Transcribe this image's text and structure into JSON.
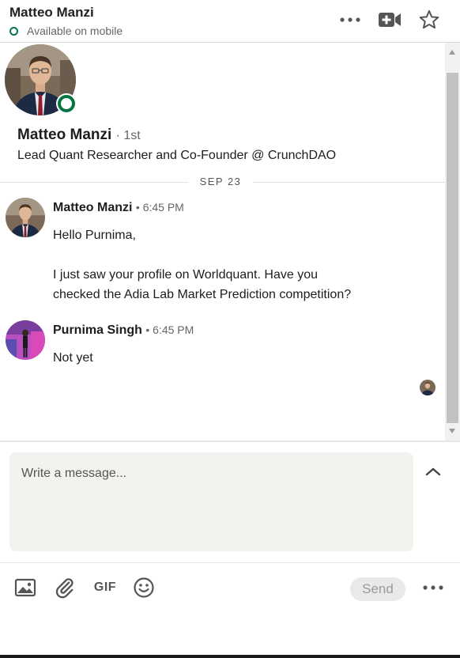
{
  "header": {
    "name": "Matteo Manzi",
    "status": "Available on mobile",
    "icons": [
      "more-icon",
      "video-call-icon",
      "star-icon"
    ]
  },
  "profile": {
    "name": "Matteo Manzi",
    "degree": "· 1st",
    "headline": "Lead Quant Researcher and Co-Founder @ CrunchDAO"
  },
  "date_divider": "SEP 23",
  "messages": [
    {
      "sender": "Matteo Manzi",
      "time": "• 6:45 PM",
      "lines": [
        "Hello Purnima,",
        "I just saw your profile on Worldquant. Have you",
        "checked the Adia Lab Market Prediction competition?"
      ]
    },
    {
      "sender": "Purnima Singh",
      "time": "• 6:45 PM",
      "lines": [
        "Not yet"
      ]
    }
  ],
  "composer": {
    "placeholder": "Write a message...",
    "gif_label": "GIF",
    "send_label": "Send"
  },
  "colors": {
    "presence_green": "#057642",
    "composer_bg": "#f3f2ef",
    "send_disabled_bg": "#e9e9e9"
  }
}
